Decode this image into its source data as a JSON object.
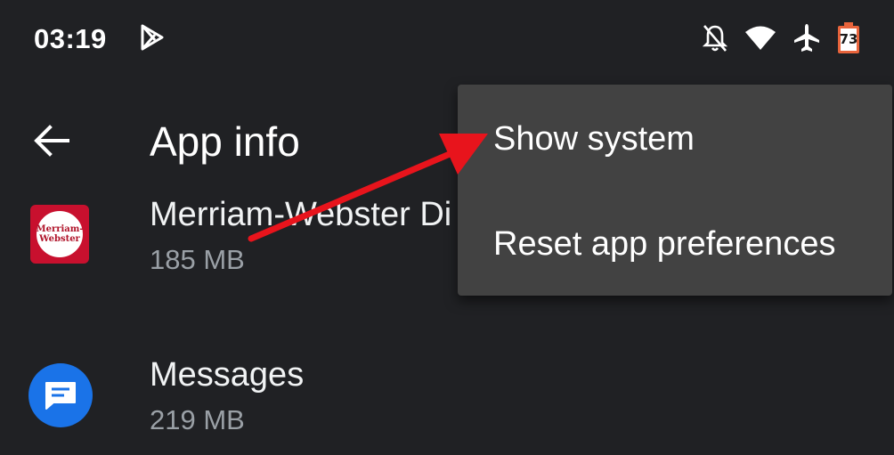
{
  "status_bar": {
    "time": "03:19",
    "battery_level": "73",
    "icons": [
      "google-play-icon",
      "notifications-off-icon",
      "wifi-icon",
      "airplane-mode-icon",
      "battery-icon"
    ]
  },
  "toolbar": {
    "back_icon": "arrow-left-icon",
    "title": "App info"
  },
  "apps": [
    {
      "name": "Merriam-Webster Di",
      "size": "185 MB",
      "icon": "merriam-webster-icon",
      "icon_text": [
        "Merriam-",
        "Webster"
      ]
    },
    {
      "name": "Messages",
      "size": "219 MB",
      "icon": "messages-icon"
    }
  ],
  "overflow_menu": {
    "items": [
      {
        "label": "Show system"
      },
      {
        "label": "Reset app preferences"
      }
    ]
  },
  "colors": {
    "background": "#202124",
    "menu_background": "#424242",
    "annotation_arrow": "#e8141c",
    "messages_blue": "#1a73e8",
    "mw_red": "#c8102e",
    "battery_orange": "#e8643c"
  }
}
